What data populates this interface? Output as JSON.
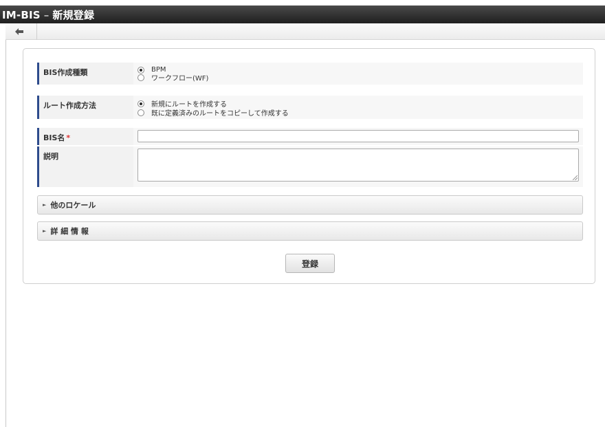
{
  "window": {
    "app": "IM-BIS",
    "separator": " – ",
    "page": "新規登録"
  },
  "toolbar": {
    "back_icon": "back-arrow-icon"
  },
  "form": {
    "bis_type": {
      "label": "BIS作成種類",
      "options": [
        {
          "text": "BPM",
          "checked": true
        },
        {
          "text": "ワークフロー(WF)",
          "checked": false
        }
      ]
    },
    "route_method": {
      "label": "ルート作成方法",
      "options": [
        {
          "text": "新規にルートを作成する",
          "checked": true
        },
        {
          "text": "既に定義済みのルートをコピーして作成する",
          "checked": false
        }
      ]
    },
    "bis_name": {
      "label": "BIS名",
      "required_mark": "*",
      "value": ""
    },
    "description": {
      "label": "説明",
      "value": ""
    }
  },
  "sections": {
    "other_locale": "他のロケール",
    "details": "詳 細 情 報"
  },
  "actions": {
    "register_label": "登録"
  },
  "colors": {
    "title_bar": "#2b2b2b",
    "label_accent": "#2d4b8c",
    "required": "#dd3333"
  }
}
